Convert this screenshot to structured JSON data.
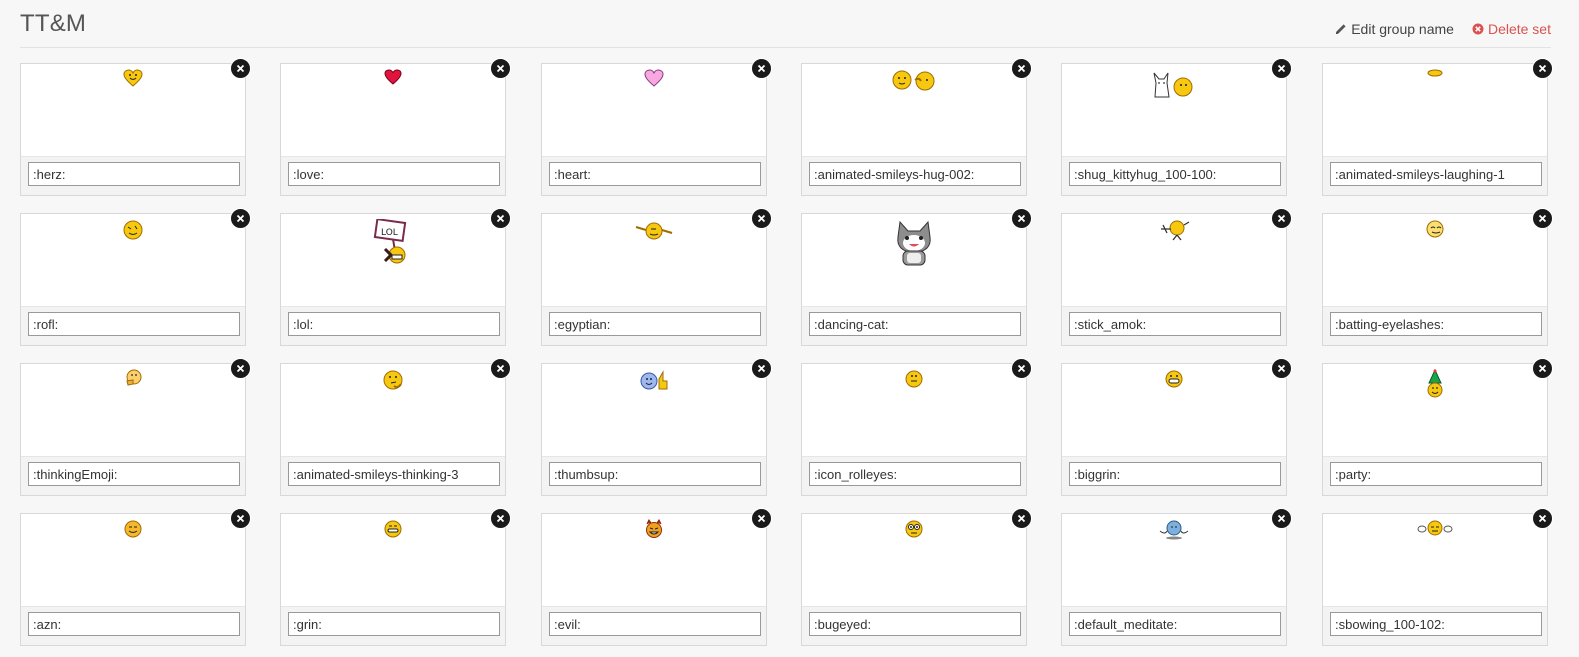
{
  "header": {
    "title": "TT&M",
    "edit_label": "Edit group name",
    "delete_label": "Delete set"
  },
  "colors": {
    "delete": "#d9534f",
    "remove_button": "#1a1a1a",
    "smiley_yellow": "#f5c400"
  },
  "smileys": [
    {
      "code": ":herz:",
      "icon": "heart-smiley-icon"
    },
    {
      "code": ":love:",
      "icon": "red-heart-icon"
    },
    {
      "code": ":heart:",
      "icon": "pink-heart-icon"
    },
    {
      "code": ":animated-smileys-hug-002:",
      "icon": "hugging-smileys-icon"
    },
    {
      "code": ":shug_kittyhug_100-100:",
      "icon": "kitty-hug-icon"
    },
    {
      "code": ":animated-smileys-laughing-1",
      "icon": "laughing-smiley-icon"
    },
    {
      "code": ":rofl:",
      "icon": "rofl-smiley-icon"
    },
    {
      "code": ":lol:",
      "icon": "lol-sign-smiley-icon"
    },
    {
      "code": ":egyptian:",
      "icon": "egyptian-smiley-icon"
    },
    {
      "code": ":dancing-cat:",
      "icon": "dancing-cat-icon"
    },
    {
      "code": ":stick_amok:",
      "icon": "stick-amok-smiley-icon"
    },
    {
      "code": ":batting-eyelashes:",
      "icon": "batting-eyelashes-smiley-icon"
    },
    {
      "code": ":thinkingEmoji:",
      "icon": "thinking-emoji-icon"
    },
    {
      "code": ":animated-smileys-thinking-3",
      "icon": "thinking-smiley-icon"
    },
    {
      "code": ":thumbsup:",
      "icon": "thumbsup-smiley-icon"
    },
    {
      "code": ":icon_rolleyes:",
      "icon": "rolleyes-smiley-icon"
    },
    {
      "code": ":biggrin:",
      "icon": "biggrin-smiley-icon"
    },
    {
      "code": ":party:",
      "icon": "party-hat-smiley-icon"
    },
    {
      "code": ":azn:",
      "icon": "azn-smiley-icon"
    },
    {
      "code": ":grin:",
      "icon": "grin-smiley-icon"
    },
    {
      "code": ":evil:",
      "icon": "evil-smiley-icon"
    },
    {
      "code": ":bugeyed:",
      "icon": "bugeyed-smiley-icon"
    },
    {
      "code": ":default_meditate:",
      "icon": "meditate-smiley-icon"
    },
    {
      "code": ":sbowing_100-102:",
      "icon": "bowing-smiley-icon"
    }
  ]
}
